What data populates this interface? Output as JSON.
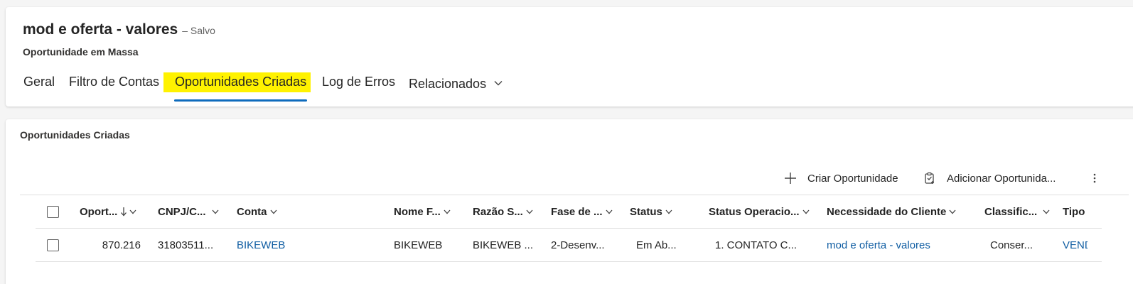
{
  "record": {
    "title": "mod e oferta - valores",
    "save_status": "– Salvo",
    "entity": "Oportunidade em Massa"
  },
  "tabs": [
    {
      "label": "Geral"
    },
    {
      "label": "Filtro de Contas"
    },
    {
      "label": "Oportunidades Criadas",
      "active": true
    },
    {
      "label": "Log de Erros"
    },
    {
      "label": "Relacionados",
      "has_dropdown": true
    }
  ],
  "highlight_color": "#fff200",
  "accent_color": "#0f6cbd",
  "link_color": "#115ea3",
  "subgrid": {
    "title": "Oportunidades Criadas",
    "commands": [
      {
        "label": "Criar Oportunidade",
        "icon": "plus-icon"
      },
      {
        "label": "Adicionar Oportunida...",
        "icon": "clipboard-add-icon"
      },
      {
        "label": "",
        "icon": "more-vertical-icon"
      }
    ],
    "columns": [
      {
        "label": "Oport...",
        "sort": "descending"
      },
      {
        "label": "CNPJ/C..."
      },
      {
        "label": "Conta"
      },
      {
        "label": "Nome F..."
      },
      {
        "label": "Razão S..."
      },
      {
        "label": "Fase de ..."
      },
      {
        "label": "Status"
      },
      {
        "label": "Status Operacio..."
      },
      {
        "label": "Necessidade do Cliente"
      },
      {
        "label": "Classific..."
      },
      {
        "label": "Tipo"
      }
    ],
    "rows": [
      {
        "oportunidade": "870.216",
        "cnpj": "31803511...",
        "conta": "BIKEWEB",
        "nome_fantasia": "BIKEWEB",
        "razao_social": "BIKEWEB ...",
        "fase": "2-Desenv...",
        "status": "Em Ab...",
        "status_operacional": "1. CONTATO C...",
        "necessidade": "mod e oferta - valores",
        "classificacao": "Conser...",
        "tipo": "VEND"
      }
    ]
  }
}
